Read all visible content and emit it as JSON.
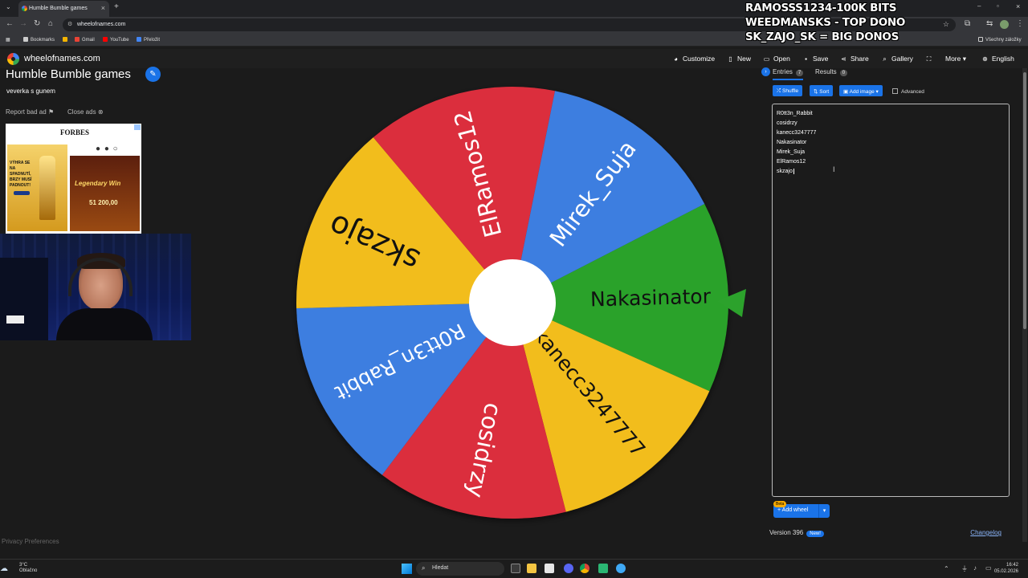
{
  "browser": {
    "tab_title": "Humble Bumble games",
    "url": "wheelofnames.com",
    "bookmarks": [
      "Bookmarks",
      "Gmail",
      "YouTube",
      "Přeložit"
    ],
    "all_bookmarks": "Všechny záložky"
  },
  "overlay": {
    "lines": [
      "RAMOSSS1234-100K BITS",
      "WEEDMANSKS - TOP DONO",
      "SK_ZAJO_SK = BIG DONOS"
    ]
  },
  "header": {
    "brand": "wheelofnames.com",
    "menu": [
      "Customize",
      "New",
      "Open",
      "Save",
      "Share",
      "Gallery",
      "",
      "More",
      "English"
    ]
  },
  "left": {
    "title": "Humble Bumble games",
    "description": "veverka s gunem",
    "report_ad": "Report bad ad",
    "close_ads": "Close ads",
    "ad_text": [
      "FORBES",
      "VÝHRA SE NA SPADNUTÍ, BRZY MUSÍ PADNOUT!",
      "Legendary Win",
      "51 200,00"
    ],
    "privacy": "Privacy Preferences"
  },
  "wheel": {
    "slices": [
      {
        "label": "Nakasinator",
        "color": "#2ca22c"
      },
      {
        "label": "kanecc3247777",
        "color": "#f2bd1d"
      },
      {
        "label": "cosidrzy",
        "color": "#db2e3d"
      },
      {
        "label": "R0tt3n_Rabbit",
        "color": "#3d7ee0"
      },
      {
        "label": "skzajo",
        "color": "#f2bd1d"
      },
      {
        "label": "ElRamos12",
        "color": "#db2e3d"
      },
      {
        "label": "Mirek_Suja",
        "color": "#3d7ee0"
      }
    ],
    "pointer_color": "#2ca22c"
  },
  "sidebar": {
    "entries_tab": "Entries",
    "entries_count": "7",
    "results_tab": "Results",
    "results_count": "0",
    "shuffle": "Shuffle",
    "sort": "Sort",
    "add_image": "Add image",
    "advanced": "Advanced",
    "entries": [
      "R0tt3n_Rabbit",
      "cosidrzy",
      "kanecc3247777",
      "Nakasinator",
      "Mirek_Suja",
      "ElRamos12",
      "skzajo"
    ],
    "beta": "Beta",
    "add_wheel": "Add wheel",
    "version": "Version 396",
    "new_badge": "New!",
    "changelog": "Changelog"
  },
  "taskbar": {
    "temp": "3°C",
    "weather": "Oblačno",
    "search": "Hledat",
    "time": "16:42",
    "date": "05.02.2026"
  }
}
